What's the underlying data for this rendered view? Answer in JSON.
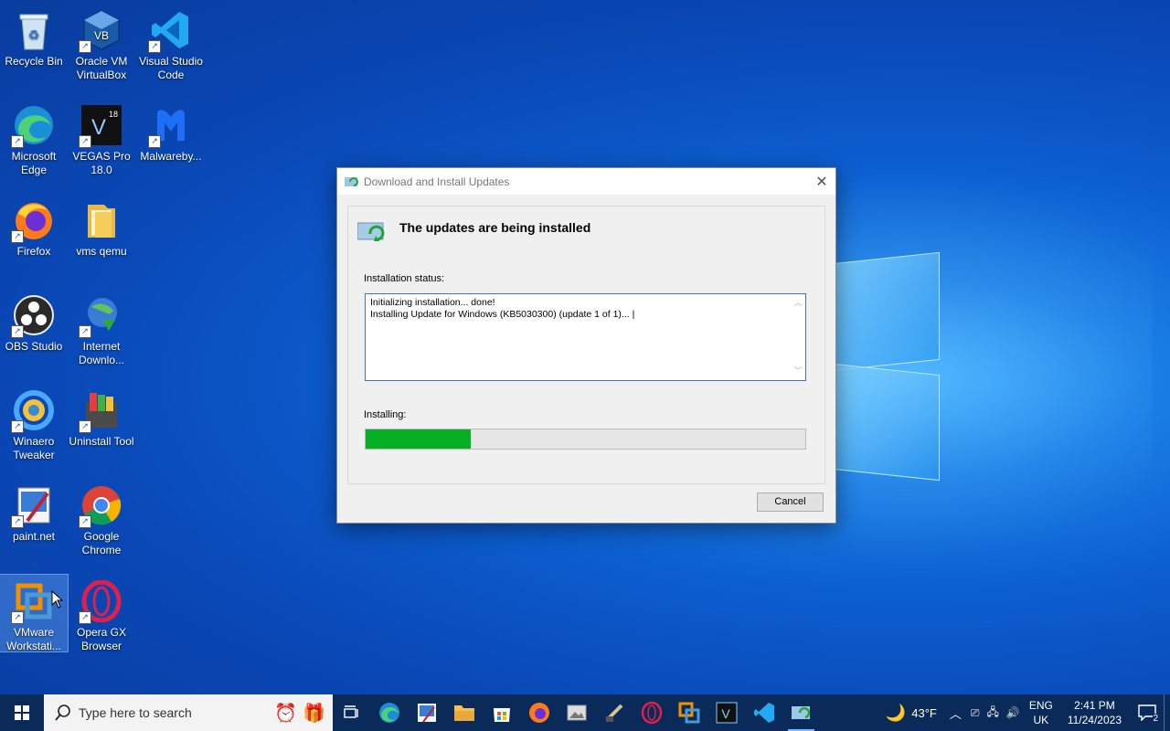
{
  "desktop": {
    "icons": [
      {
        "label": "Recycle Bin"
      },
      {
        "label": "Oracle VM VirtualBox"
      },
      {
        "label": "Visual Studio Code"
      },
      {
        "label": "Microsoft Edge"
      },
      {
        "label": "VEGAS Pro 18.0"
      },
      {
        "label": "Malwareby..."
      },
      {
        "label": "Firefox"
      },
      {
        "label": "vms qemu"
      },
      {
        "label": "OBS Studio"
      },
      {
        "label": "Internet Downlo..."
      },
      {
        "label": "Winaero Tweaker"
      },
      {
        "label": "Uninstall Tool"
      },
      {
        "label": "paint.net"
      },
      {
        "label": "Google Chrome"
      },
      {
        "label": "VMware Workstati..."
      },
      {
        "label": "Opera GX Browser"
      }
    ]
  },
  "dialog": {
    "title": "Download and Install Updates",
    "heading": "The updates are being installed",
    "status_label": "Installation status:",
    "status_lines": [
      "Initializing installation... done!",
      "Installing Update for Windows (KB5030300) (update 1 of 1)... |"
    ],
    "progress_label": "Installing:",
    "progress_fraction": 0.24,
    "cancel_label": "Cancel"
  },
  "taskbar": {
    "search_placeholder": "Type here to search",
    "weather": "43°F",
    "language": "ENG",
    "region": "UK",
    "time": "2:41 PM",
    "date": "11/24/2023",
    "notification_count": "2"
  }
}
